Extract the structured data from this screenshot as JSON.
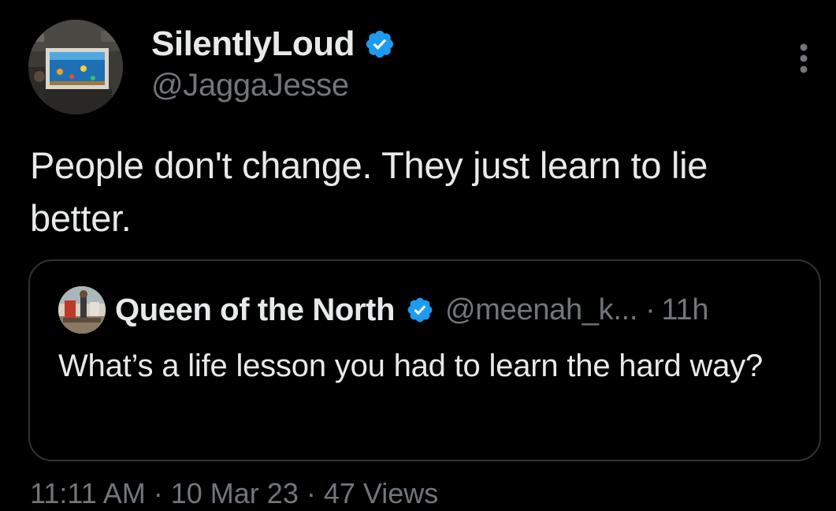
{
  "colors": {
    "background": "#000000",
    "text_primary": "#e7e9ea",
    "text_secondary": "#71767b",
    "verified_blue": "#1d9bf0",
    "card_border": "#2f3336"
  },
  "author": {
    "display_name": "SilentlyLoud",
    "handle": "@JaggaJesse",
    "verified": true,
    "avatar_icon": "avatar-photo"
  },
  "more_menu_icon": "more-vertical-icon",
  "tweet": {
    "text": "People don't change. They just learn to lie better."
  },
  "quote": {
    "display_name": "Queen of the North",
    "handle": "@meenah_k...",
    "separator": "·",
    "time": "11h",
    "verified": true,
    "text": "What’s a life lesson you had to learn the hard way?"
  },
  "footer": {
    "timestamp_partial": "11:11 AM · 10 Mar 23 · 47 Views"
  }
}
